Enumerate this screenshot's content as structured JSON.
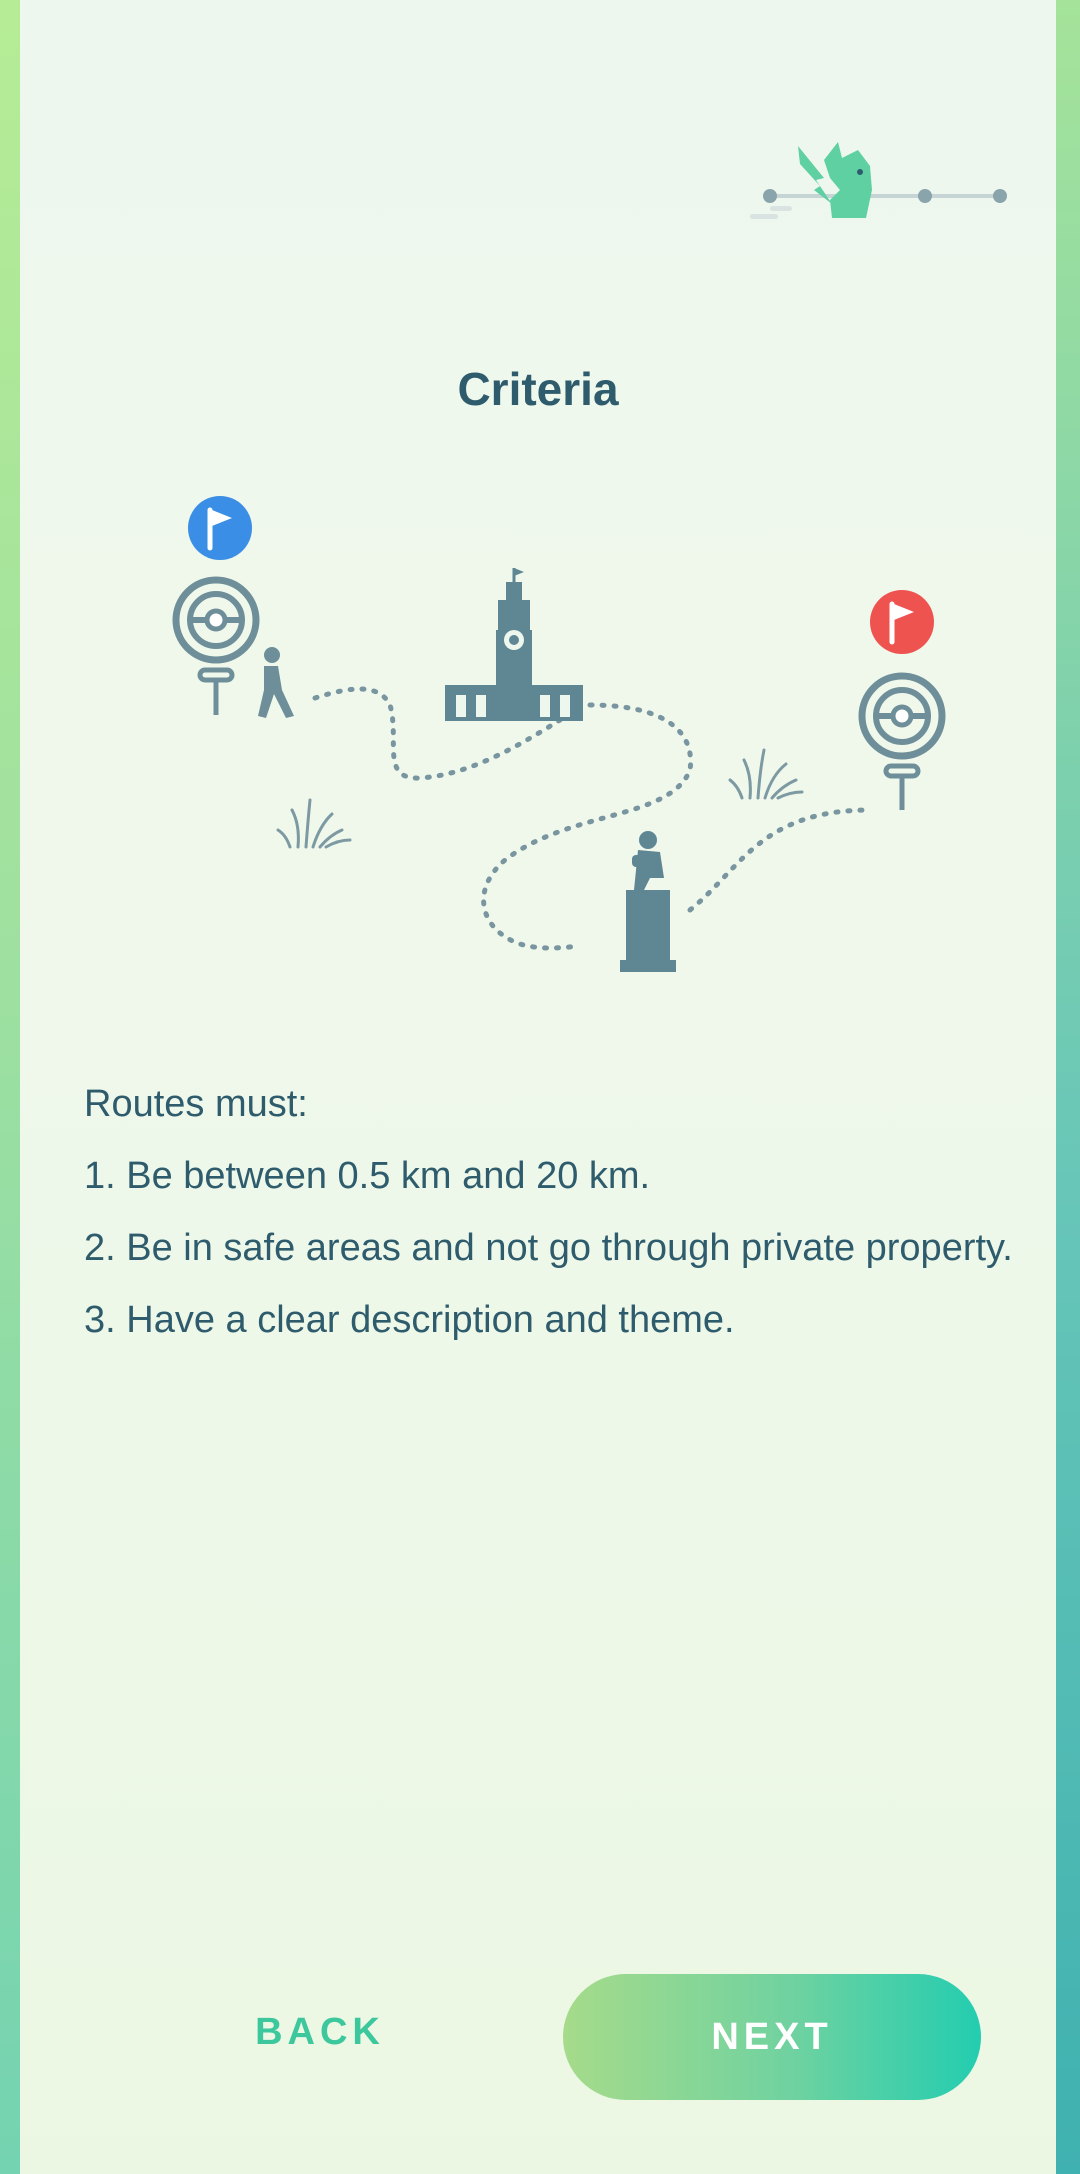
{
  "header": {
    "title": "Criteria",
    "progress": {
      "total_steps": 4,
      "current_step": 2
    }
  },
  "rules": {
    "intro": "Routes must:",
    "items": [
      "1. Be between 0.5 km and 20 km.",
      "2. Be in safe areas and not go through private property.",
      "3. Have a clear description and theme."
    ]
  },
  "footer": {
    "back_label": "BACK",
    "next_label": "NEXT"
  },
  "colors": {
    "title_text": "#2f5c6d",
    "accent_green": "#3cc79d",
    "start_flag": "#3a8ee6",
    "end_flag": "#ef5350",
    "illustration": "#5f8793"
  },
  "icons": [
    "pikachu-progress-icon",
    "start-flag-icon",
    "end-flag-icon",
    "pokestop-icon",
    "walker-icon",
    "clock-tower-icon",
    "statue-icon",
    "grass-icon"
  ]
}
